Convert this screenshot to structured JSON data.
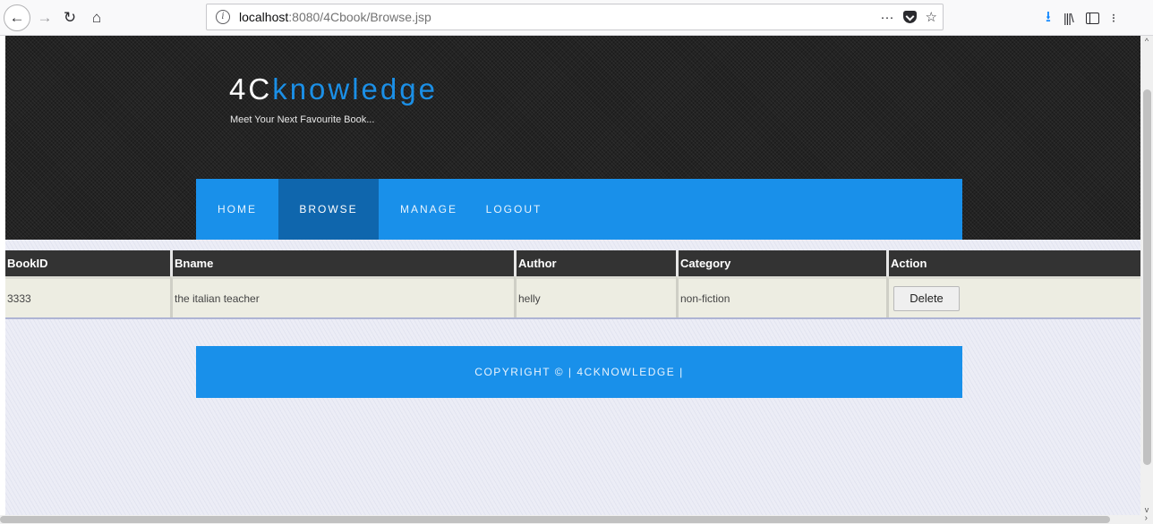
{
  "browser": {
    "url_host": "localhost",
    "url_rest": ":8080/4Cbook/Browse.jsp",
    "more_actions": "···"
  },
  "site": {
    "logo_part1": "4C",
    "logo_part2": "knowledge",
    "tagline": "Meet Your Next Favourite Book...",
    "accent_color": "#1990ea"
  },
  "nav": {
    "items": [
      {
        "label": "HOME"
      },
      {
        "label": "BROWSE",
        "active": true
      },
      {
        "label": "MANAGE"
      },
      {
        "label": "LOGOUT"
      }
    ]
  },
  "table": {
    "headers": [
      "BookID",
      "Bname",
      "Author",
      "Category",
      "Action"
    ],
    "rows": [
      {
        "id": "3333",
        "name": "the italian teacher",
        "author": "helly",
        "category": "non-fiction",
        "action": "Delete"
      }
    ]
  },
  "footer": {
    "text": "COPYRIGHT © | 4CKNOWLEDGE |"
  }
}
